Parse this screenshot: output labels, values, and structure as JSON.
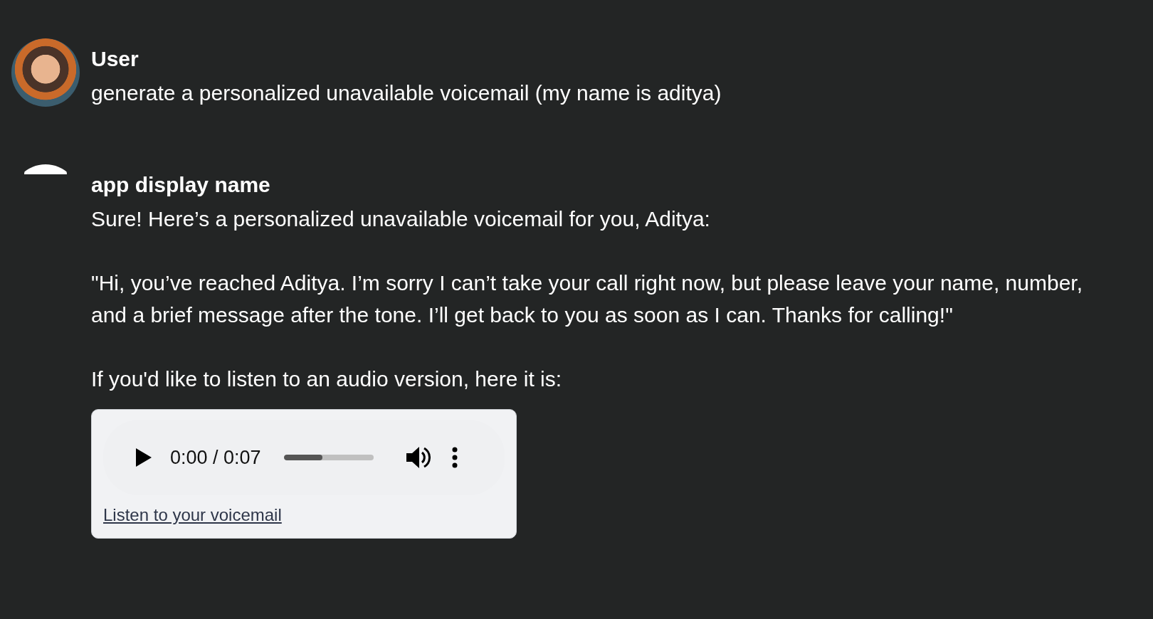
{
  "messages": [
    {
      "author": "User",
      "avatar": {
        "kind": "photo"
      },
      "paragraphs": [
        "generate a personalized unavailable voicemail (my name is aditya)"
      ]
    },
    {
      "author": "app display name",
      "avatar": {
        "kind": "blank"
      },
      "paragraphs": [
        "Sure! Here’s a personalized unavailable voicemail for you, Aditya:",
        "\"Hi, you’ve reached Aditya. I’m sorry I can’t take your call right now, but please leave your name, number, and a brief message after the tone. I’ll get back to you as soon as I can. Thanks for calling!\"",
        "If you'd like to listen to an audio version, here it is:"
      ],
      "audio": {
        "time": "0:00 / 0:07",
        "level": 0.43,
        "link": "Listen to your voicemail"
      }
    }
  ]
}
